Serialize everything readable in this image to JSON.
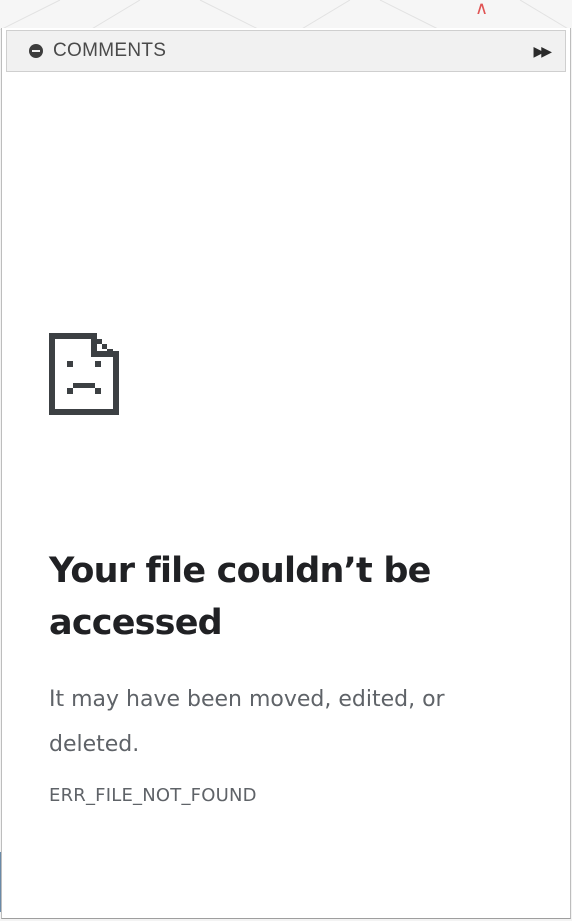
{
  "comments_panel": {
    "title": "COMMENTS",
    "collapse_icon": "minus-circle-icon",
    "expand_icon": "double-chevron-right-icon",
    "expand_glyph": "▶▶"
  },
  "error": {
    "icon": "sad-file-icon",
    "title": "Your file couldn’t be accessed",
    "message": "It may have been moved, edited, or deleted.",
    "code": "ERR_FILE_NOT_FOUND"
  },
  "background": {
    "corner_glyph": "∧"
  },
  "colors": {
    "title_text": "#202124",
    "body_text": "#5f6368",
    "panel_header_bg": "#f1f1f1",
    "accent_red": "#e05555"
  }
}
